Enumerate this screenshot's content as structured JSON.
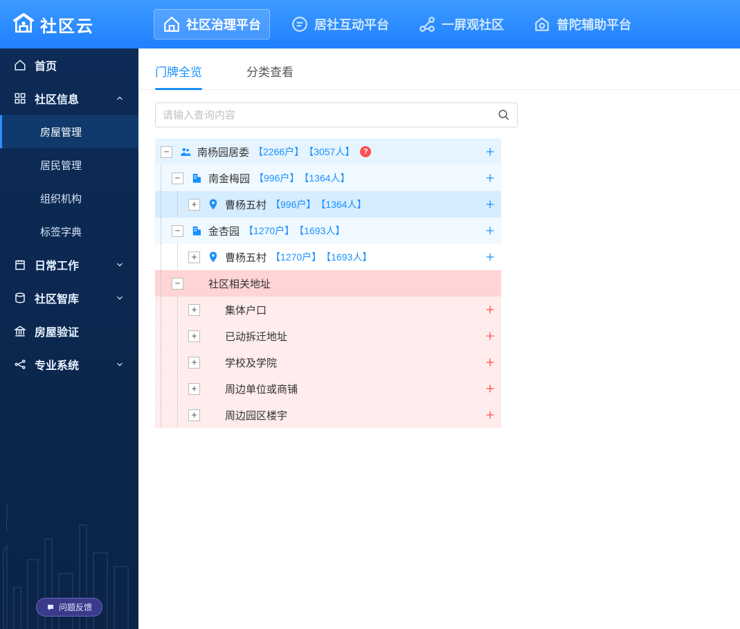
{
  "brand": "社区云",
  "top_tabs": [
    {
      "label": "社区治理平台"
    },
    {
      "label": "居社互动平台"
    },
    {
      "label": "一屏观社区"
    },
    {
      "label": "普陀辅助平台"
    }
  ],
  "sidebar": {
    "home": "首页",
    "community_info": {
      "label": "社区信息",
      "items": [
        {
          "label": "房屋管理"
        },
        {
          "label": "居民管理"
        },
        {
          "label": "组织机构"
        },
        {
          "label": "标签字典"
        }
      ]
    },
    "daily_work": "日常工作",
    "think_tank": "社区智库",
    "house_verify": "房屋验证",
    "pro_system": "专业系统",
    "feedback": "问题反馈"
  },
  "content_tabs": [
    {
      "label": "门牌全览"
    },
    {
      "label": "分类查看"
    }
  ],
  "search": {
    "placeholder": "请输入查询内容"
  },
  "tree": {
    "root": {
      "icon": "group",
      "label": "南杨园居委",
      "stat1": "【2266户】",
      "stat2": "【3057人】",
      "warn": "?",
      "children": [
        {
          "icon": "building",
          "label": "南金梅园",
          "stat1": "【996户】",
          "stat2": "【1364人】",
          "children": [
            {
              "icon": "pin",
              "label": "曹杨五村",
              "stat1": "【996户】",
              "stat2": "【1364人】",
              "selected": true
            }
          ]
        },
        {
          "icon": "building",
          "label": "金杏园",
          "stat1": "【1270户】",
          "stat2": "【1693人】",
          "children": [
            {
              "icon": "pin",
              "label": "曹杨五村",
              "stat1": "【1270户】",
              "stat2": "【1693人】"
            }
          ]
        },
        {
          "kind": "related_header",
          "label": "社区相关地址",
          "children": [
            {
              "label": "集体户口"
            },
            {
              "label": "已动拆迁地址"
            },
            {
              "label": "学校及学院"
            },
            {
              "label": "周边单位或商铺"
            },
            {
              "label": "周边园区楼宇"
            }
          ]
        }
      ]
    }
  }
}
